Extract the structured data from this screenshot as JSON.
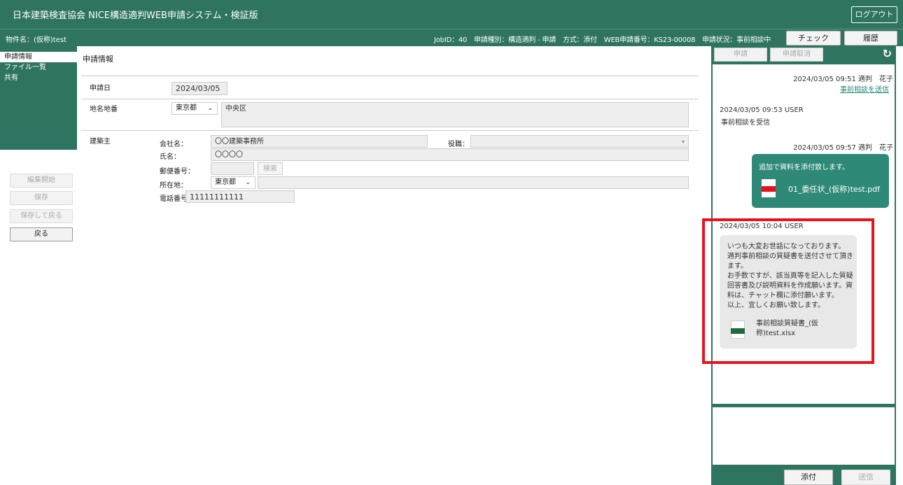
{
  "header": {
    "title": "日本建築検査協会 NICE構造適判WEB申請システム・検証版",
    "logout": "ログアウト"
  },
  "infobar": {
    "project": "物件名：(仮称)test",
    "meta": "JobID：40　申請種別：構造適判 - 申請　方式：添付　WEB申請番号：KS23-00008　申請状況：事前相談中",
    "check_button": "チェック",
    "history_button": "履歴"
  },
  "sidebar": {
    "items": [
      {
        "label": "申請情報"
      },
      {
        "label": "ファイル一覧"
      },
      {
        "label": "共有"
      }
    ],
    "buttons": {
      "edit": "編集開始",
      "save": "保存",
      "save_back": "保存して戻る",
      "back": "戻る"
    }
  },
  "main": {
    "heading": "申請情報",
    "date_label": "申請日",
    "date_value": "2024/03/05",
    "location_label": "地名地番",
    "prefecture": "東京都",
    "location_value": "中央区",
    "owner_label": "建築主",
    "company_label": "会社名：",
    "company_value": "〇〇建築事務所",
    "position_label": "役職：",
    "name_label": "氏名：",
    "name_value": "〇〇〇〇",
    "postal_label": "郵便番号：",
    "search_button": "検索",
    "address_label": "所在地：",
    "address_prefecture": "東京都",
    "phone_label": "電話番号：",
    "phone_value": "11111111111"
  },
  "right": {
    "apply_button": "申請",
    "cancel_button": "申請取消",
    "messages": {
      "m1_stamp": "2024/03/05 09:51 適判　花子",
      "m1_link": "事前相談を送信",
      "m2_stamp": "2024/03/05 09:53 USER",
      "m2_text": "事前相談を受信",
      "m3_stamp": "2024/03/05 09:57 適判　花子",
      "m3_text": "追加で資料を添付致します。",
      "m3_file": "01_委任状_(仮称)test.pdf",
      "m4_stamp": "2024/03/05 10:04 USER",
      "m4_lines": [
        "いつも大変お世話になっております。",
        "適判事前相談の質疑書を送付させて頂き",
        "ます。",
        "お手数ですが、該当頁等を記入した質疑",
        "回答書及び説明資料を作成願います。資",
        "料は、チャット欄に添付願います。",
        "以上、宜しくお願い致します。"
      ],
      "m4_file_line1": "事前相談質疑書_(仮",
      "m4_file_line2": "称)test.xlsx"
    },
    "attach_button": "添付",
    "send_button": "送信"
  },
  "colors": {
    "brand": "#2e7461",
    "highlight": "#e8131b",
    "pdf": "#e0141e",
    "excel": "#1d6b3a"
  }
}
